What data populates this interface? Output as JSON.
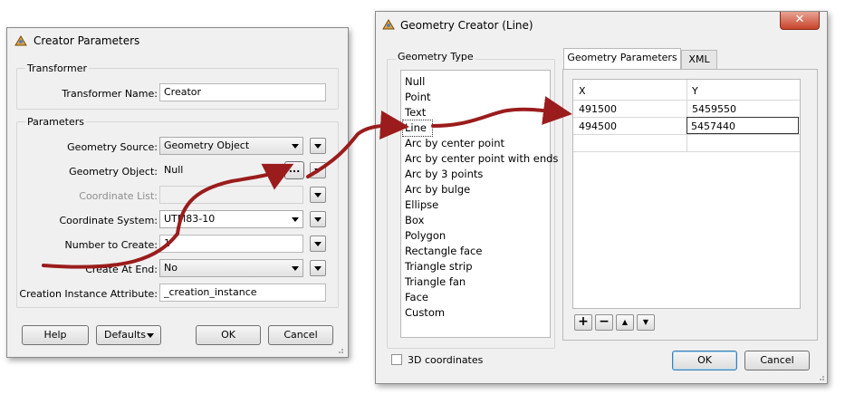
{
  "creator_dialog": {
    "title": "Creator Parameters",
    "transformer_group": "Transformer",
    "transformer_name_label": "Transformer Name:",
    "transformer_name_value": "Creator",
    "parameters_group": "Parameters",
    "geometry_source_label": "Geometry Source:",
    "geometry_source_value": "Geometry Object",
    "geometry_object_label": "Geometry Object:",
    "geometry_object_value": "Null",
    "ellipsis_label": "...",
    "coordinate_list_label": "Coordinate List:",
    "coordinate_list_value": "",
    "coordinate_system_label": "Coordinate System:",
    "coordinate_system_value": "UTM83-10",
    "number_to_create_label": "Number to Create:",
    "number_to_create_value": "1",
    "create_at_end_label": "Create At End:",
    "create_at_end_value": "No",
    "creation_instance_label": "Creation Instance Attribute:",
    "creation_instance_value": "_creation_instance",
    "help_button": "Help",
    "defaults_button": "Defaults",
    "ok_button": "OK",
    "cancel_button": "Cancel"
  },
  "geometry_dialog": {
    "title": "Geometry Creator (Line)",
    "close_glyph": "✕",
    "geometry_type_group": "Geometry Type",
    "geometry_types": [
      "Null",
      "Point",
      "Text",
      "Line",
      "Arc by center point",
      "Arc by center point with ends",
      "Arc by 3 points",
      "Arc by bulge",
      "Ellipse",
      "Box",
      "Polygon",
      "Rectangle face",
      "Triangle strip",
      "Triangle fan",
      "Face",
      "Custom"
    ],
    "selected_type": "Line",
    "tabs": [
      "Geometry Parameters",
      "XML"
    ],
    "active_tab": "Geometry Parameters",
    "columns": [
      "X",
      "Y"
    ],
    "rows": [
      [
        "491500",
        "5459550"
      ],
      [
        "494500",
        "5457440"
      ]
    ],
    "row_controls": [
      "+",
      "−",
      "▲",
      "▼"
    ],
    "three_d_label": "3D coordinates",
    "three_d_checked": false,
    "ok_button": "OK",
    "cancel_button": "Cancel"
  },
  "colors": {
    "arrow": "#9b1c1c",
    "dialog_bg": "#f0f0f0",
    "close_button": "#c7432b"
  }
}
